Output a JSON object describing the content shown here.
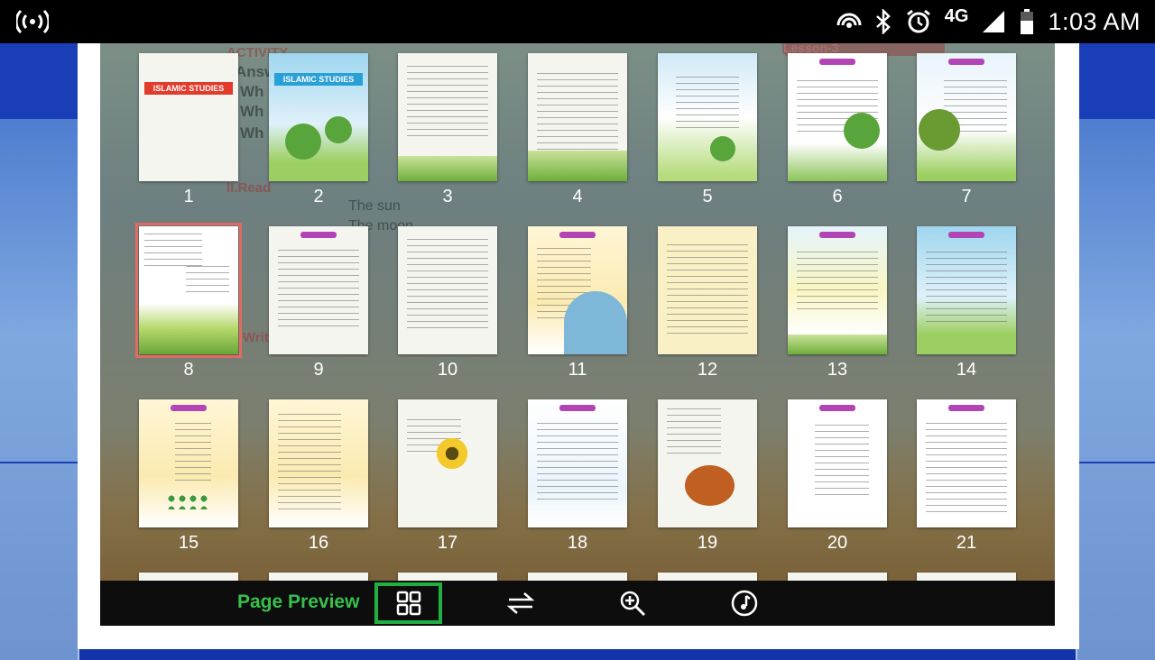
{
  "status_bar": {
    "time": "1:03 AM",
    "network": "4G",
    "icons": [
      "wifi-tethering-icon",
      "cast-icon",
      "bluetooth-icon",
      "alarm-icon",
      "signal-icon",
      "battery-icon"
    ]
  },
  "background_text": {
    "lesson": "Lesson-3",
    "lines": [
      "ACTIVITY",
      "Answ",
      "Wh",
      "Wh",
      "Wh",
      "II.Read",
      "The sun",
      "The moon",
      "Writ"
    ]
  },
  "thumbnails": [
    {
      "number": "1",
      "title": "ISLAMIC STUDIES"
    },
    {
      "number": "2",
      "title": "ISLAMIC STUDIES"
    },
    {
      "number": "3"
    },
    {
      "number": "4"
    },
    {
      "number": "5"
    },
    {
      "number": "6"
    },
    {
      "number": "7"
    },
    {
      "number": "8",
      "selected": true
    },
    {
      "number": "9"
    },
    {
      "number": "10"
    },
    {
      "number": "11"
    },
    {
      "number": "12"
    },
    {
      "number": "13"
    },
    {
      "number": "14"
    },
    {
      "number": "15"
    },
    {
      "number": "16"
    },
    {
      "number": "17"
    },
    {
      "number": "18"
    },
    {
      "number": "19"
    },
    {
      "number": "20"
    },
    {
      "number": "21"
    }
  ],
  "toolbar": {
    "label": "Page Preview",
    "buttons": [
      "grid-icon",
      "swap-icon",
      "zoom-in-icon",
      "music-icon"
    ],
    "accent": "#37c04c"
  }
}
